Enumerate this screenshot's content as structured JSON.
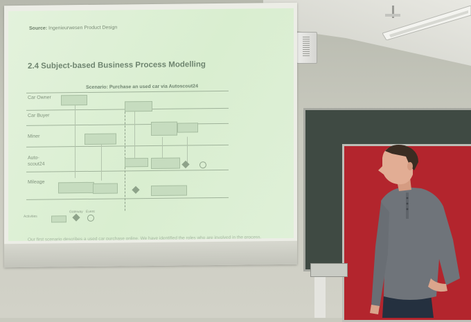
{
  "slide": {
    "source_label": "Source:",
    "source_text": "Ingenieurwesen Product Design",
    "title": "2.4 Subject-based Business Process Modelling",
    "scenario": "Scenario:  Purchase an used car via Autoscout24",
    "lanes": [
      "Car Owner",
      "Car Buyer",
      "Miner",
      "Auto-\nscout24",
      "Mileage"
    ],
    "footer": "Our first scenario describes a used car purchase online. We have identified the roles who are involved in the process.",
    "legend_items": [
      "Activities",
      "Gateway",
      "Event"
    ]
  },
  "colors": {
    "slide_bg": "#dff0d8",
    "board_green": "#3f4a43",
    "board_red": "#b3252d"
  }
}
